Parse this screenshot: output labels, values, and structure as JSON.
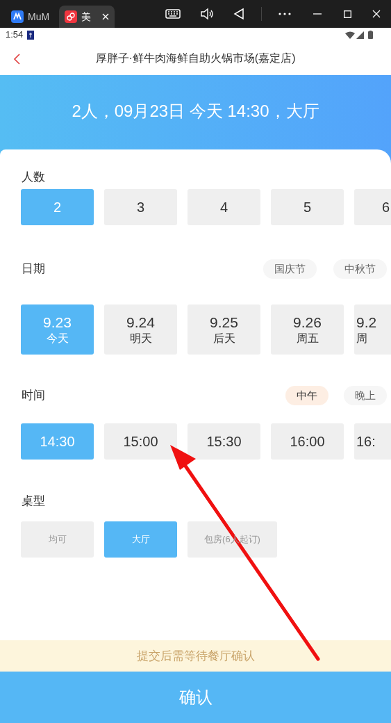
{
  "emulator_bar": {
    "tabs": [
      {
        "label": "MuM",
        "selected": false
      },
      {
        "label": "美",
        "selected": true
      }
    ]
  },
  "status_bar": {
    "time": "1:54"
  },
  "header": {
    "title": "厚胖子·鲜牛肉海鲜自助火锅市场(嘉定店)"
  },
  "summary": "2人，09月23日 今天 14:30，大厅",
  "party_size": {
    "label": "人数",
    "options": [
      {
        "label": "2",
        "selected": true
      },
      {
        "label": "3",
        "selected": false
      },
      {
        "label": "4",
        "selected": false
      },
      {
        "label": "5",
        "selected": false
      },
      {
        "label": "6",
        "selected": false
      }
    ]
  },
  "date": {
    "label": "日期",
    "chips": [
      {
        "label": "国庆节",
        "selected": false
      },
      {
        "label": "中秋节",
        "selected": false
      }
    ],
    "options": [
      {
        "date": "9.23",
        "day": "今天",
        "selected": true
      },
      {
        "date": "9.24",
        "day": "明天",
        "selected": false
      },
      {
        "date": "9.25",
        "day": "后天",
        "selected": false
      },
      {
        "date": "9.26",
        "day": "周五",
        "selected": false
      },
      {
        "date": "9.2",
        "day": "周",
        "selected": false
      }
    ]
  },
  "time": {
    "label": "时间",
    "chips": [
      {
        "label": "中午",
        "selected": true
      },
      {
        "label": "晚上",
        "selected": false
      }
    ],
    "options": [
      {
        "label": "14:30",
        "selected": true
      },
      {
        "label": "15:00",
        "selected": false
      },
      {
        "label": "15:30",
        "selected": false
      },
      {
        "label": "16:00",
        "selected": false
      },
      {
        "label": "16:",
        "selected": false
      }
    ]
  },
  "table_type": {
    "label": "桌型",
    "options": [
      {
        "label": "均可",
        "selected": false,
        "disabled": true
      },
      {
        "label": "大厅",
        "selected": true,
        "disabled": false
      },
      {
        "label": "包房(6人起订)",
        "selected": false,
        "disabled": true
      }
    ]
  },
  "notice": "提交后需等待餐厅确认",
  "confirm_button": "确认"
}
